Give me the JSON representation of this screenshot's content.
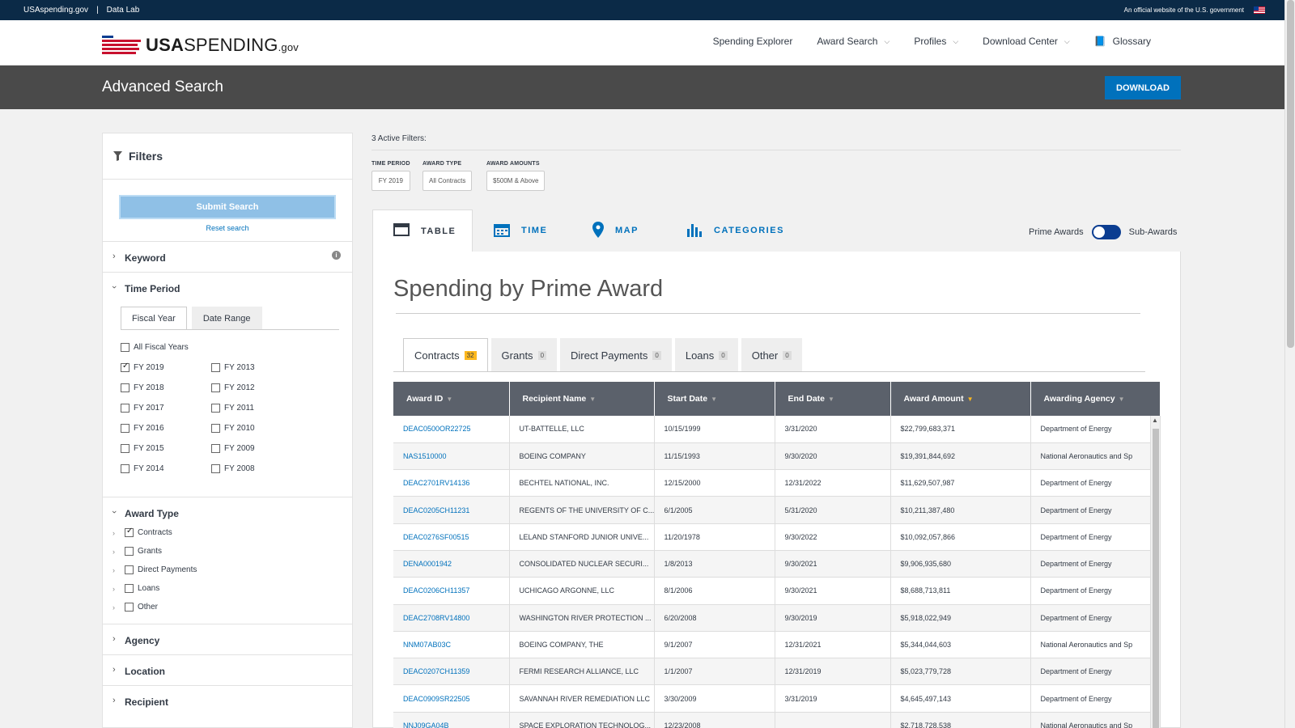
{
  "gov_bar": {
    "links": [
      "USAspending.gov",
      "|",
      "Data Lab"
    ],
    "official": "An official website of the U.S. government"
  },
  "header": {
    "logo": {
      "main": "USA",
      "rest": "SPENDING",
      "suffix": ".gov"
    },
    "nav": [
      {
        "label": "Spending Explorer",
        "dropdown": false
      },
      {
        "label": "Award Search",
        "dropdown": true
      },
      {
        "label": "Profiles",
        "dropdown": true
      },
      {
        "label": "Download Center",
        "dropdown": true
      },
      {
        "label": "Glossary",
        "dropdown": false,
        "icon": "book-icon"
      }
    ]
  },
  "page": {
    "title": "Advanced Search",
    "download_label": "DOWNLOAD"
  },
  "sidebar": {
    "title": "Filters",
    "submit": "Submit Search",
    "reset": "Reset search",
    "keyword": "Keyword",
    "time_period": "Time Period",
    "tabs": [
      "Fiscal Year",
      "Date Range"
    ],
    "all_years": "All Fiscal Years",
    "years_left": [
      {
        "label": "FY 2019",
        "checked": true
      },
      {
        "label": "FY 2018",
        "checked": false
      },
      {
        "label": "FY 2017",
        "checked": false
      },
      {
        "label": "FY 2016",
        "checked": false
      },
      {
        "label": "FY 2015",
        "checked": false
      },
      {
        "label": "FY 2014",
        "checked": false
      }
    ],
    "years_right": [
      {
        "label": "FY 2013",
        "checked": false
      },
      {
        "label": "FY 2012",
        "checked": false
      },
      {
        "label": "FY 2011",
        "checked": false
      },
      {
        "label": "FY 2010",
        "checked": false
      },
      {
        "label": "FY 2009",
        "checked": false
      },
      {
        "label": "FY 2008",
        "checked": false
      }
    ],
    "award_type": "Award Type",
    "award_types": [
      {
        "label": "Contracts",
        "checked": true
      },
      {
        "label": "Grants",
        "checked": false
      },
      {
        "label": "Direct Payments",
        "checked": false
      },
      {
        "label": "Loans",
        "checked": false
      },
      {
        "label": "Other",
        "checked": false
      }
    ],
    "agency": "Agency",
    "location": "Location",
    "recipient": "Recipient"
  },
  "filters": {
    "active_label": "3 Active Filters:",
    "groups": [
      {
        "label": "TIME PERIOD",
        "chip": "FY 2019"
      },
      {
        "label": "AWARD TYPE",
        "chip": "All Contracts"
      },
      {
        "label": "AWARD AMOUNTS",
        "chip": "$500M & Above"
      }
    ]
  },
  "view_tabs": [
    {
      "label": "TABLE",
      "icon": "table-icon",
      "active": true
    },
    {
      "label": "TIME",
      "icon": "calendar-icon",
      "active": false
    },
    {
      "label": "MAP",
      "icon": "map-pin-icon",
      "active": false
    },
    {
      "label": "CATEGORIES",
      "icon": "bar-chart-icon",
      "active": false
    }
  ],
  "toggle": {
    "left": "Prime Awards",
    "right": "Sub-Awards"
  },
  "panel": {
    "title": "Spending by Prime Award"
  },
  "award_tabs": [
    {
      "label": "Contracts",
      "count": "32",
      "active": true
    },
    {
      "label": "Grants",
      "count": "0",
      "active": false
    },
    {
      "label": "Direct Payments",
      "count": "0",
      "active": false
    },
    {
      "label": "Loans",
      "count": "0",
      "active": false
    },
    {
      "label": "Other",
      "count": "0",
      "active": false
    }
  ],
  "table": {
    "columns": [
      "Award ID",
      "Recipient Name",
      "Start Date",
      "End Date",
      "Award Amount",
      "Awarding Agency"
    ],
    "sorted_column": "Award Amount",
    "rows": [
      [
        "DEAC0500OR22725",
        "UT-BATTELLE, LLC",
        "10/15/1999",
        "3/31/2020",
        "$22,799,683,371",
        "Department of Energy"
      ],
      [
        "NAS1510000",
        "BOEING COMPANY",
        "11/15/1993",
        "9/30/2020",
        "$19,391,844,692",
        "National Aeronautics and Sp"
      ],
      [
        "DEAC2701RV14136",
        "BECHTEL NATIONAL, INC.",
        "12/15/2000",
        "12/31/2022",
        "$11,629,507,987",
        "Department of Energy"
      ],
      [
        "DEAC0205CH11231",
        "REGENTS OF THE UNIVERSITY OF C...",
        "6/1/2005",
        "5/31/2020",
        "$10,211,387,480",
        "Department of Energy"
      ],
      [
        "DEAC0276SF00515",
        "LELAND STANFORD JUNIOR UNIVE...",
        "11/20/1978",
        "9/30/2022",
        "$10,092,057,866",
        "Department of Energy"
      ],
      [
        "DENA0001942",
        "CONSOLIDATED NUCLEAR SECURI...",
        "1/8/2013",
        "9/30/2021",
        "$9,906,935,680",
        "Department of Energy"
      ],
      [
        "DEAC0206CH11357",
        "UCHICAGO ARGONNE, LLC",
        "8/1/2006",
        "9/30/2021",
        "$8,688,713,811",
        "Department of Energy"
      ],
      [
        "DEAC2708RV14800",
        "WASHINGTON RIVER PROTECTION ...",
        "6/20/2008",
        "9/30/2019",
        "$5,918,022,949",
        "Department of Energy"
      ],
      [
        "NNM07AB03C",
        "BOEING COMPANY, THE",
        "9/1/2007",
        "12/31/2021",
        "$5,344,044,603",
        "National Aeronautics and Sp"
      ],
      [
        "DEAC0207CH11359",
        "FERMI RESEARCH ALLIANCE, LLC",
        "1/1/2007",
        "12/31/2019",
        "$5,023,779,728",
        "Department of Energy"
      ],
      [
        "DEAC0909SR22505",
        "SAVANNAH RIVER REMEDIATION LLC",
        "3/30/2009",
        "3/31/2019",
        "$4,645,497,143",
        "Department of Energy"
      ],
      [
        "NNJ09GA04B",
        "SPACE EXPLORATION TECHNOLOG...",
        "12/23/2008",
        "",
        "$2,718,728,538",
        "National Aeronautics and Sp"
      ]
    ]
  }
}
